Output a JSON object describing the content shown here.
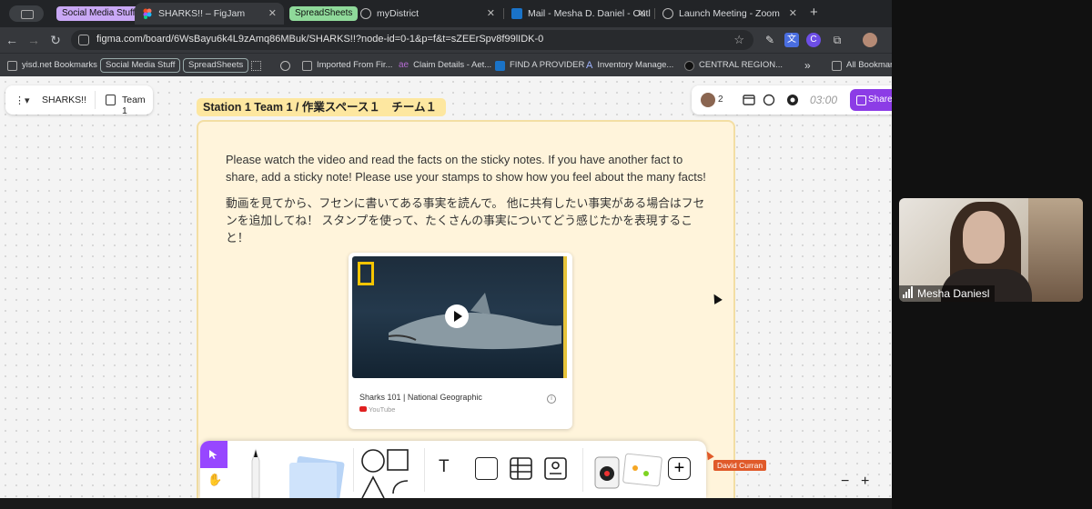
{
  "browser": {
    "tab_groups": [
      {
        "label": "Social Media Stuff",
        "color": "#c9a8f5"
      },
      {
        "label": "SpreadSheets",
        "color": "#8fd99a"
      }
    ],
    "tabs": [
      {
        "title": "SHARKS!! – FigJam",
        "active": true
      },
      {
        "title": "myDistrict",
        "active": false
      },
      {
        "title": "Mail - Mesha D. Daniel - Outl",
        "active": false
      },
      {
        "title": "Launch Meeting - Zoom",
        "active": false
      }
    ],
    "url": "figma.com/board/6WsBayu6k4L9zAmq86MBuk/SHARKS!!?node-id=0-1&p=f&t=sZEErSpv8f99lIDK-0",
    "extension_letter": "C",
    "bookmarks": [
      "yisd.net Bookmarks",
      "Social Media Stuff",
      "SpreadSheets",
      "Imported From Fir...",
      "Claim Details - Aet...",
      "FIND A PROVIDER",
      "Inventory Manage...",
      "CENTRAL REGION...",
      "All Bookmarks"
    ],
    "bookmark_prefix": "ae",
    "bookmark_more": "»"
  },
  "figjam": {
    "file_name": "SHARKS!!",
    "page_name": "Team 1",
    "collaborator_count": "2",
    "timer": "03:00",
    "share_label": "Share",
    "section_title": "Station 1 Team 1 / 作業スペース１　チーム１",
    "instructions_en": "Please watch the video and read the facts on the sticky notes.  If you have another fact to share, add a sticky note!  Please use your stamps to show how you feel about the many facts!",
    "instructions_ja": "動画を見てから、フセンに書いてある事実を読んで。 他に共有したい事実がある場合はフセンを追加してね！ スタンプを使って、たくさんの事実についてどう感じたかを表現すること！",
    "video": {
      "title": "Sharks 101 | National Geographic",
      "source": "YouTube",
      "info": "i"
    },
    "remote_cursor_name": "David Curran",
    "text_tool": "T",
    "zoom_minus": "−",
    "zoom_plus": "+",
    "add_symbol": "+"
  },
  "zoom": {
    "participant_name": "Mesha Daniesl"
  },
  "colors": {
    "accent": "#9747ff",
    "section_bg": "#fff4db",
    "section_label_bg": "#fde7a0",
    "remote_cursor": "#e05a2a"
  }
}
